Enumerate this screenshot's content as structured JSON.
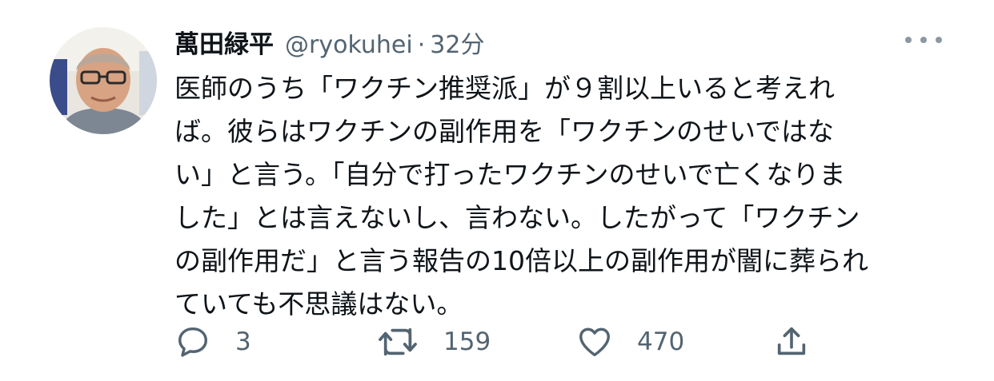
{
  "author": {
    "name": "萬田緑平",
    "handle": "@ryokuhei",
    "separator": "·",
    "time": "32分"
  },
  "tweet_lines": [
    "医師のうち「ワクチン推奨派」が９割以上いると考えれ",
    "ば。彼らはワクチンの副作用を「ワクチンのせいではな",
    "い」と言う。「自分で打ったワクチンのせいで亡くなりま",
    "した」とは言えないし、言わない。したがって「ワクチン",
    "の副作用だ」と言う報告の10倍以上の副作用が闇に葬られ",
    "ていても不思議はない。"
  ],
  "actions": {
    "reply": {
      "icon": "reply-icon",
      "count": "3"
    },
    "retweet": {
      "icon": "retweet-icon",
      "count": "159"
    },
    "like": {
      "icon": "heart-icon",
      "count": "470"
    },
    "share": {
      "icon": "share-icon"
    }
  },
  "colors": {
    "text": "#0f1419",
    "secondary": "#536471",
    "background": "#ffffff"
  }
}
